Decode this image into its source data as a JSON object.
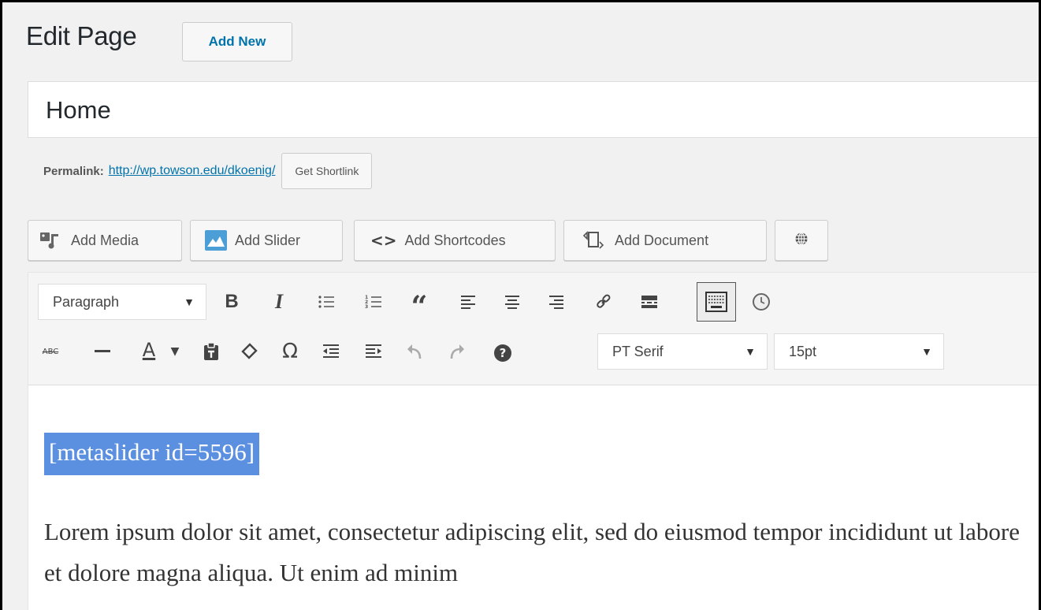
{
  "header": {
    "title": "Edit Page",
    "add_new": "Add New"
  },
  "title_field": {
    "value": "Home"
  },
  "permalink": {
    "label": "Permalink:",
    "url": "http://wp.towson.edu/dkoenig/",
    "shortlink_button": "Get Shortlink"
  },
  "media_buttons": [
    {
      "label": "Add Media",
      "icon": "add-media-icon"
    },
    {
      "label": "Add Slider",
      "icon": "metaslider-icon"
    },
    {
      "label": "Add Shortcodes",
      "icon": "code-brackets-icon"
    },
    {
      "label": "Add Document",
      "icon": "document-icon"
    },
    {
      "label": "",
      "icon": "globe-icon"
    }
  ],
  "toolbar": {
    "format_select": "Paragraph",
    "font_select": "PT Serif",
    "size_select": "15pt",
    "row1_icons": [
      "bold-icon",
      "italic-icon",
      "bullet-list-icon",
      "numbered-list-icon",
      "blockquote-icon",
      "align-left-icon",
      "align-center-icon",
      "align-right-icon",
      "link-icon",
      "read-more-icon",
      "toolbar-toggle-icon",
      "clock-icon"
    ],
    "row2_icons": [
      "strikethrough-icon",
      "horizontal-line-icon",
      "text-color-icon",
      "paste-text-icon",
      "clear-formatting-icon",
      "special-character-icon",
      "outdent-icon",
      "indent-icon",
      "undo-icon",
      "redo-icon",
      "help-icon"
    ],
    "glyphs": {
      "bold": "B",
      "italic": "I",
      "blockquote": "“",
      "omega": "Ω",
      "help": "?",
      "text_color": "A",
      "strike": "ABC"
    }
  },
  "content": {
    "shortcode": "[metaslider id=5596]",
    "paragraph": "Lorem ipsum dolor sit amet, consectetur adipiscing elit, sed do eiusmod tempor incididunt ut labore et dolore magna aliqua. Ut enim ad minim"
  }
}
